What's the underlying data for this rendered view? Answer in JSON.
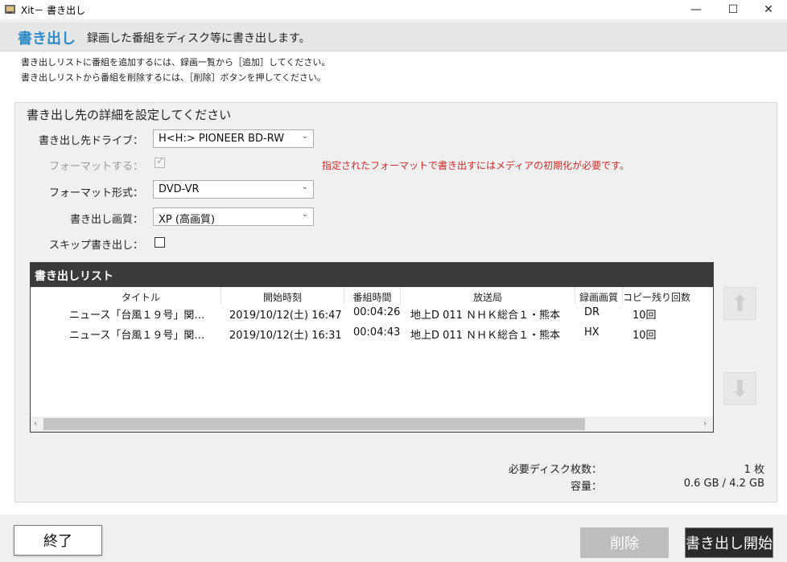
{
  "window": {
    "title": "Xit－ 書き出し",
    "minimize_glyph": "—",
    "maximize_glyph": "☐",
    "close_glyph": "✕"
  },
  "header": {
    "title": "書き出し",
    "description": "録画した番組をディスク等に書き出します。"
  },
  "instructions": [
    "書き出しリストに番組を追加するには、録画一覧から［追加］してください。",
    "書き出しリストから番組を削除するには、［削除］ボタンを押してください。"
  ],
  "settings": {
    "section_title": "書き出し先の詳細を設定してください",
    "drive_label": "書き出し先ドライブ：",
    "drive_value": "H<H:> PIONEER BD-RW",
    "format_label": "フォーマットする：",
    "format_checked": true,
    "format_warning": "指定されたフォーマットで書き出すにはメディアの初期化が必要です。",
    "format_type_label": "フォーマット形式：",
    "format_type_value": "DVD-VR",
    "quality_label": "書き出し画質：",
    "quality_value": "XP (高画質)",
    "skip_label": "スキップ書き出し：",
    "skip_checked": false
  },
  "export_list": {
    "title": "書き出しリスト",
    "columns": [
      "タイトル",
      "開始時刻",
      "番組時間",
      "放送局",
      "録画画質",
      "コピー残り回数"
    ],
    "rows": [
      {
        "title": "ニュース「台風１９号」関…",
        "start": "2019/10/12(土) 16:47",
        "duration": "00:04:26",
        "station": "地上D 011 ＮＨＫ総合１・熊本",
        "quality": "DR",
        "copies": "10回"
      },
      {
        "title": "ニュース「台風１９号」関…",
        "start": "2019/10/12(土) 16:31",
        "duration": "00:04:43",
        "station": "地上D 011 ＮＨＫ総合１・熊本",
        "quality": "HX",
        "copies": "10回"
      }
    ],
    "scroll_left_glyph": "‹",
    "scroll_right_glyph": "›"
  },
  "side": {
    "up_glyph": "⬆",
    "down_glyph": "⬇"
  },
  "summary": {
    "discs_label": "必要ディスク枚数：",
    "discs_value": "1 枚",
    "capacity_label": "容量：",
    "capacity_value": "0.6 GB / 4.2 GB"
  },
  "buttons": {
    "close": "終了",
    "delete": "削除",
    "start": "書き出し開始"
  },
  "colors": {
    "accent": "#2e8bc9",
    "warning": "#d02a2a",
    "list_header": "#3a3a3a"
  }
}
